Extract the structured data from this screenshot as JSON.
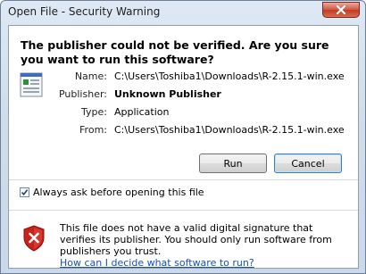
{
  "window": {
    "title": "Open File - Security Warning"
  },
  "heading": "The publisher could not be verified.  Are you sure you want to run this software?",
  "details": [
    {
      "label": "Name:",
      "value": "C:\\Users\\Toshiba1\\Downloads\\R-2.15.1-win.exe",
      "bold": false
    },
    {
      "label": "Publisher:",
      "value": "Unknown Publisher",
      "bold": true
    },
    {
      "label": "Type:",
      "value": "Application",
      "bold": false
    },
    {
      "label": "From:",
      "value": "C:\\Users\\Toshiba1\\Downloads\\R-2.15.1-win.exe",
      "bold": false
    }
  ],
  "buttons": {
    "run_label": "Run",
    "cancel_label": "Cancel"
  },
  "checkbox": {
    "label": "Always ask before opening this file",
    "checked": true
  },
  "warning": {
    "text": "This file does not have a valid digital signature that verifies its publisher.  You should only run software from publishers you trust.",
    "link_text": "How can I decide what software to run?"
  },
  "icons": {
    "close": "close-icon",
    "file": "application-file-icon",
    "shield": "security-shield-icon",
    "check": "check-icon"
  },
  "colors": {
    "link": "#1a4fbf",
    "close_button": "#c33b22",
    "shield_red": "#c8201b"
  }
}
